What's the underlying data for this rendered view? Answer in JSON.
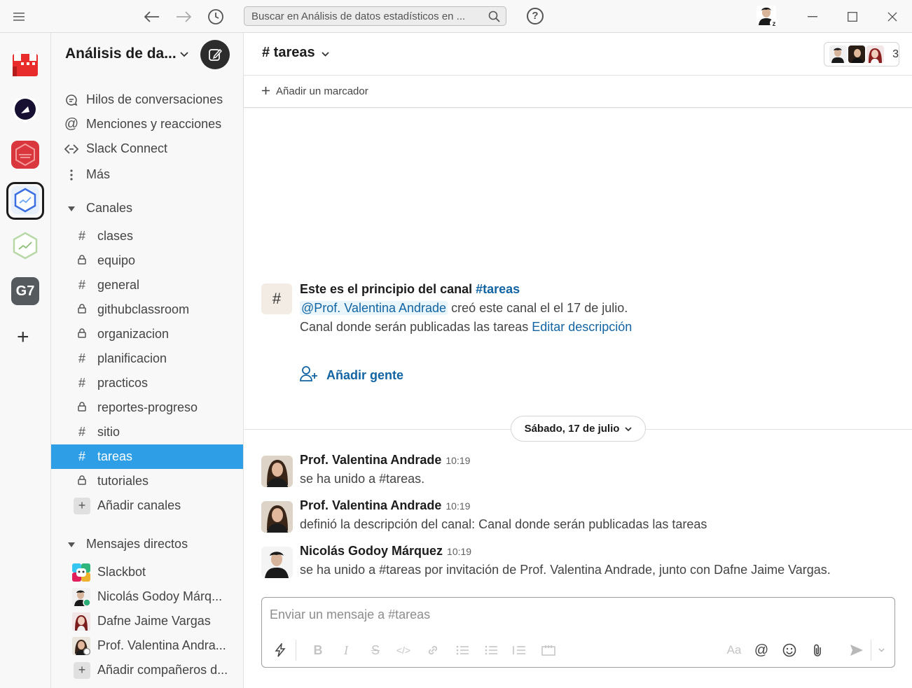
{
  "titlebar": {
    "search_placeholder": "Buscar en Análisis de datos estadísticos en ..."
  },
  "sidebar": {
    "workspace_name": "Análisis de da...",
    "nav": [
      {
        "label": "Hilos de conversaciones",
        "icon": "threads-icon"
      },
      {
        "label": "Menciones y reacciones",
        "icon": "at-icon"
      },
      {
        "label": "Slack Connect",
        "icon": "slack-connect-icon"
      },
      {
        "label": "Más",
        "icon": "more-vertical-icon"
      }
    ],
    "channels_header": "Canales",
    "channels": [
      {
        "name": "clases",
        "private": false
      },
      {
        "name": "equipo",
        "private": true
      },
      {
        "name": "general",
        "private": false
      },
      {
        "name": "githubclassroom",
        "private": true
      },
      {
        "name": "organizacion",
        "private": true
      },
      {
        "name": "planificacion",
        "private": false
      },
      {
        "name": "practicos",
        "private": false
      },
      {
        "name": "reportes-progreso",
        "private": true
      },
      {
        "name": "sitio",
        "private": false
      },
      {
        "name": "tareas",
        "private": false,
        "active": true
      },
      {
        "name": "tutoriales",
        "private": true
      }
    ],
    "add_channels": "Añadir canales",
    "dm_header": "Mensajes directos",
    "dms": [
      {
        "name": "Slackbot"
      },
      {
        "name": "Nicolás Godoy Márq..."
      },
      {
        "name": "Dafne Jaime Vargas"
      },
      {
        "name": "Prof. Valentina Andra..."
      }
    ],
    "add_teammates": "Añadir compañeros d..."
  },
  "rail": {
    "workspaces": [
      "workspace-1",
      "workspace-2",
      "workspace-3",
      "workspace-4",
      "workspace-5",
      "G7"
    ]
  },
  "channel": {
    "title": "# tareas",
    "member_count": "3",
    "bookmark": "Añadir un marcador",
    "intro_title": "Este es el principio del canal ",
    "intro_channel": "#tareas",
    "intro_mention": "@Prof. Valentina Andrade",
    "intro_created": " creó este canal el el 17 de julio.",
    "intro_desc": "Canal donde serán publicadas las tareas ",
    "intro_edit": "Editar descripción",
    "add_people": "Añadir gente",
    "date_pill": "Sábado, 17 de julio",
    "messages": [
      {
        "author": "Prof. Valentina Andrade",
        "time": "10:19",
        "text": "se ha unido a #tareas."
      },
      {
        "author": "Prof. Valentina Andrade",
        "time": "10:19",
        "text": "definió la descripción del canal: Canal donde serán publicadas las tareas"
      },
      {
        "author": "Nicolás Godoy Márquez",
        "time": "10:19",
        "text": "se ha unido a #tareas por invitación de Prof. Valentina Andrade, junto con Dafne Jaime Vargas."
      }
    ],
    "composer_placeholder": "Enviar un mensaje a #tareas",
    "composer_aa": "Aa"
  },
  "colors": {
    "active_channel": "#2e9fe6",
    "link": "#1264a3"
  }
}
